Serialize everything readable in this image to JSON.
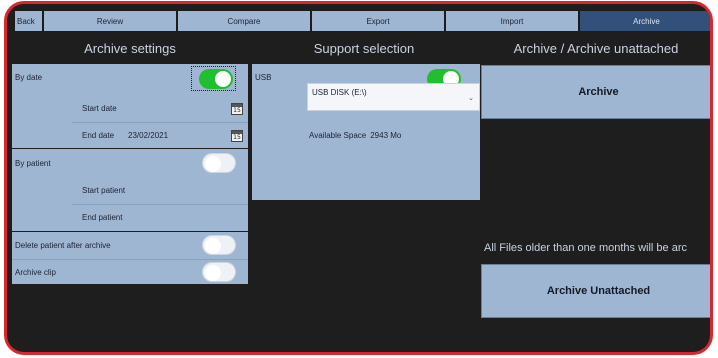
{
  "tabs": [
    {
      "label": "Back"
    },
    {
      "label": "Review"
    },
    {
      "label": "Compare"
    },
    {
      "label": "Export"
    },
    {
      "label": "Import"
    },
    {
      "label": "Archive"
    }
  ],
  "archive_settings": {
    "title": "Archive settings",
    "by_date": {
      "label": "By date",
      "enabled": true
    },
    "start_date": {
      "label": "Start date",
      "value": ""
    },
    "end_date": {
      "label": "End date",
      "value": "23/02/2021"
    },
    "calendar_day": "15",
    "by_patient": {
      "label": "By patient",
      "enabled": false
    },
    "start_patient": {
      "label": "Start patient"
    },
    "end_patient": {
      "label": "End patient"
    },
    "delete_after": {
      "label": "Delete patient after archive",
      "enabled": false
    },
    "archive_clip": {
      "label": "Archive clip",
      "enabled": false
    }
  },
  "support": {
    "title": "Support selection",
    "usb": {
      "label": "USB",
      "enabled": true
    },
    "device": {
      "value": "USB DISK (E:\\)"
    },
    "space": {
      "label": "Available Space",
      "value": "2943 Mo"
    }
  },
  "archive_panel": {
    "title": "Archive / Archive unattached",
    "archive_button": "Archive",
    "info_text": "All Files older than one months will be arc",
    "unattached_button": "Archive Unattached"
  },
  "colors": {
    "panel": "#9fb6d2",
    "active_tab": "#33507a",
    "toggle_on": "#1fbf2f",
    "background": "#1e1e1e",
    "frame": "#d9262f"
  }
}
